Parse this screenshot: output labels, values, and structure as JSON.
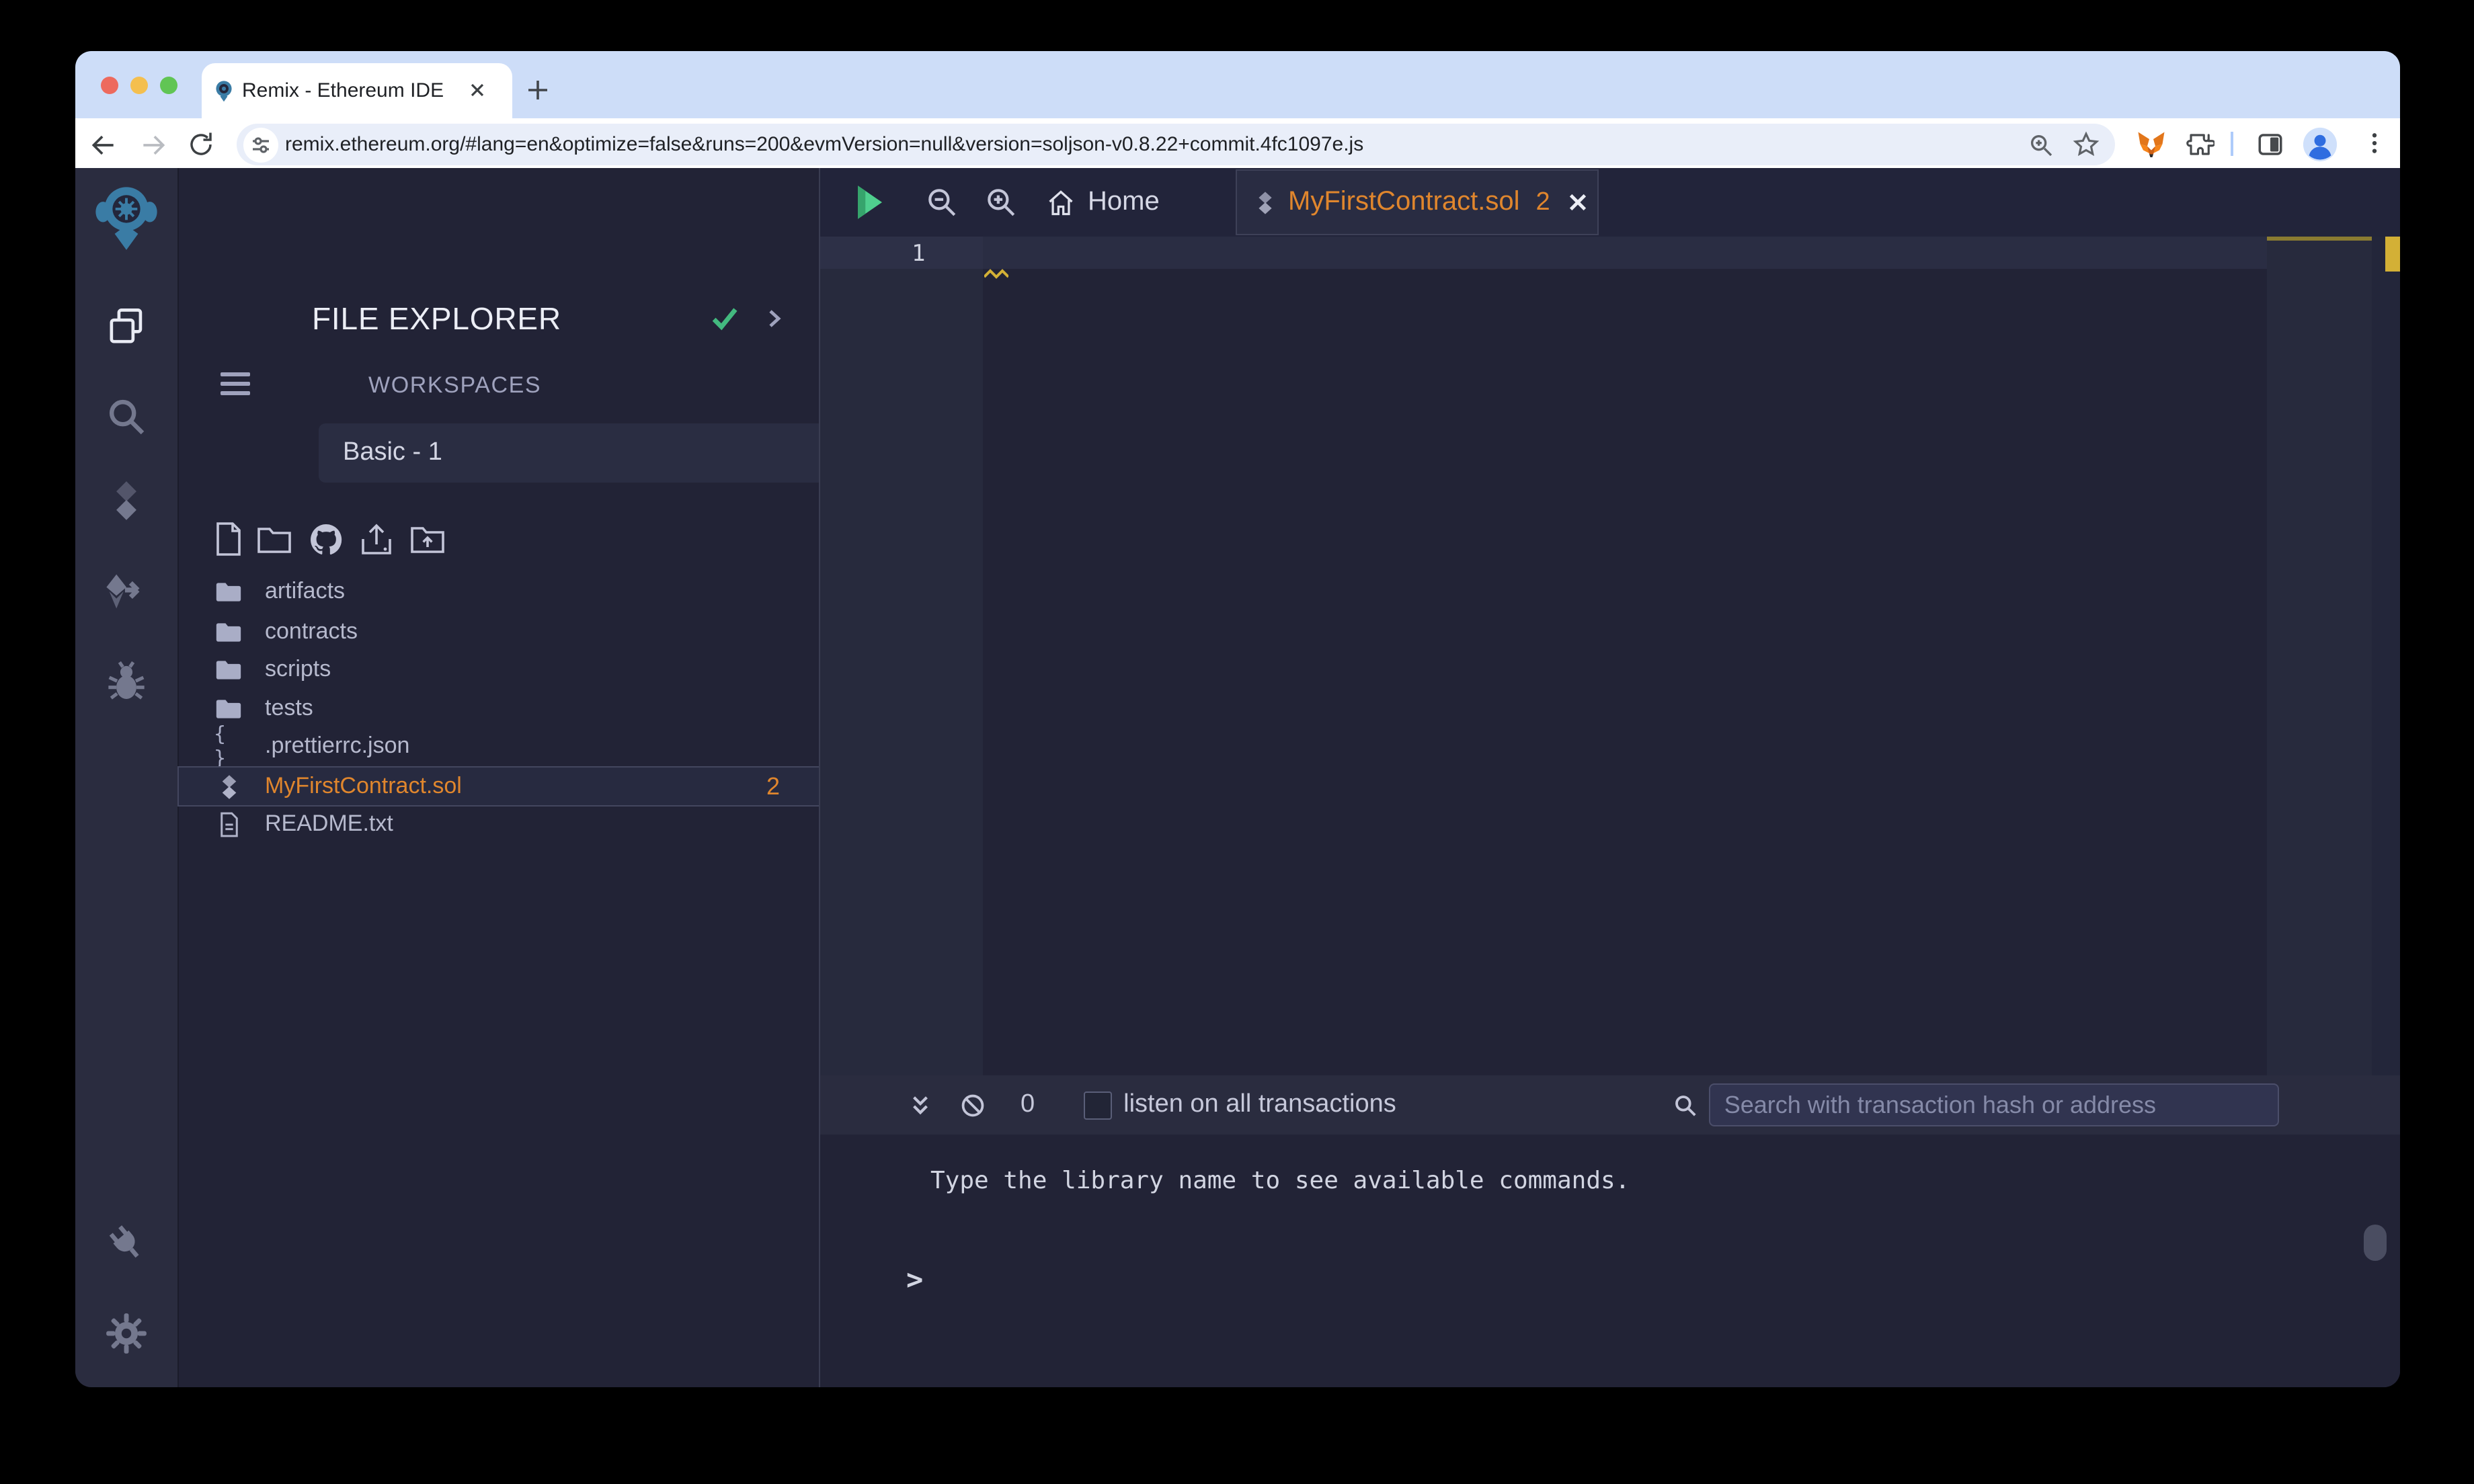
{
  "browser": {
    "tab_title": "Remix - Ethereum IDE",
    "url": "remix.ethereum.org/#lang=en&optimize=false&runs=200&evmVersion=null&version=soljson-v0.8.22+commit.4fc1097e.js"
  },
  "activity_bar": {
    "items": [
      "remix-logo",
      "file-explorer",
      "search",
      "solidity-compiler",
      "deploy-and-run",
      "debugger",
      "plugin-manager",
      "settings"
    ]
  },
  "file_explorer": {
    "title": "FILE EXPLORER",
    "workspaces_label": "WORKSPACES",
    "workspace_name": "Basic - 1",
    "files": [
      {
        "name": "artifacts",
        "type": "folder"
      },
      {
        "name": "contracts",
        "type": "folder"
      },
      {
        "name": "scripts",
        "type": "folder"
      },
      {
        "name": "tests",
        "type": "folder"
      },
      {
        "name": ".prettierrc.json",
        "type": "json"
      },
      {
        "name": "MyFirstContract.sol",
        "type": "solidity",
        "selected": true,
        "badge": "2"
      },
      {
        "name": "README.txt",
        "type": "text"
      }
    ],
    "json_glyph": "{ }"
  },
  "editor": {
    "home_tab_label": "Home",
    "active_tab": {
      "label": "MyFirstContract.sol",
      "badge": "2"
    },
    "line_number": "1"
  },
  "terminal": {
    "pending_count": "0",
    "listen_label": "listen on all transactions",
    "search_placeholder": "Search with transaction hash or address",
    "message": "Type the library name to see available commands.",
    "prompt": ">"
  },
  "colors": {
    "accent_orange": "#e0862d",
    "check_green": "#43b97f",
    "warning_yellow": "#d3b036",
    "logo_blue": "#3a7ca5"
  }
}
